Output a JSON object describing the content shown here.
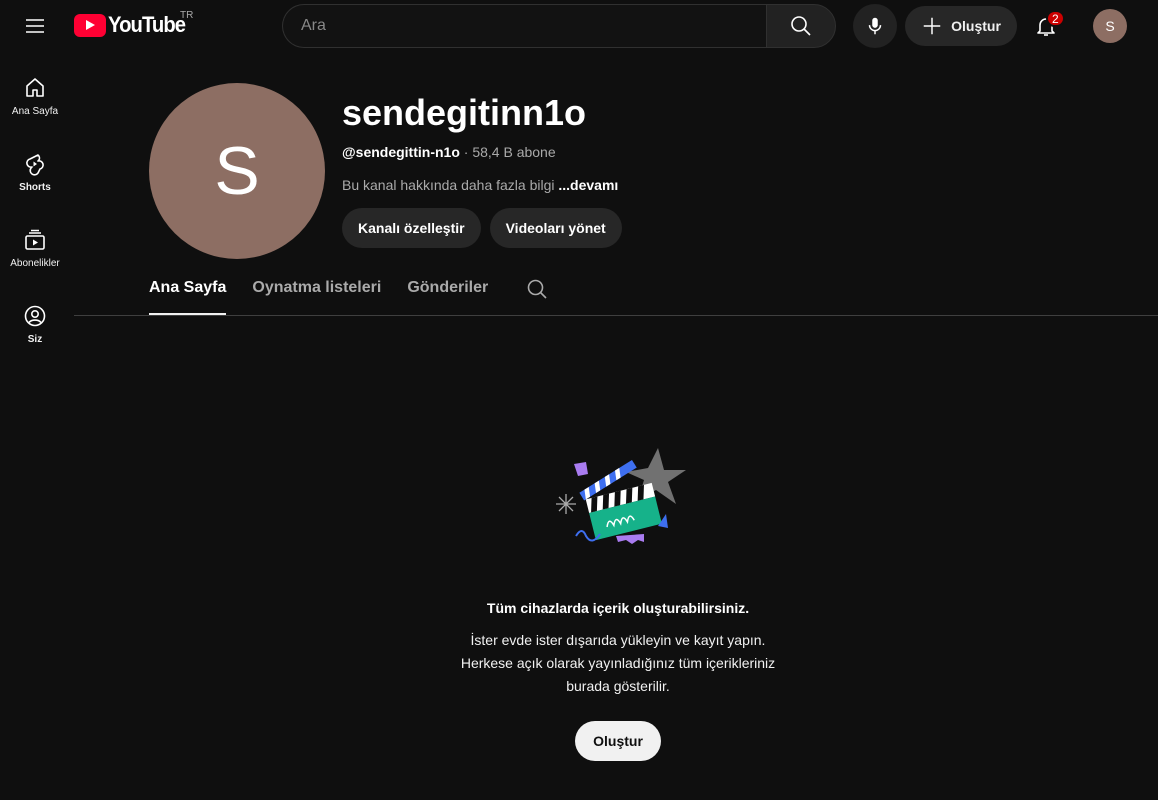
{
  "topbar": {
    "logo_text": "YouTube",
    "country_code": "TR",
    "search_placeholder": "Ara",
    "create_label": "Oluştur",
    "notification_count": "2",
    "avatar_letter": "S"
  },
  "sidebar": {
    "items": [
      {
        "label": "Ana Sayfa",
        "icon": "home-icon"
      },
      {
        "label": "Shorts",
        "icon": "shorts-icon"
      },
      {
        "label": "Abonelikler",
        "icon": "subscriptions-icon"
      },
      {
        "label": "Siz",
        "icon": "you-icon"
      }
    ]
  },
  "channel": {
    "avatar_letter": "S",
    "name": "sendegitinn1o",
    "handle": "@sendegittin-n1o",
    "separator": " · ",
    "subscribers": "58,4 B abone",
    "description": "Bu kanal hakkında daha fazla bilgi ",
    "more_label": "...devamı",
    "customize_label": "Kanalı özelleştir",
    "manage_label": "Videoları yönet"
  },
  "tabs": [
    {
      "label": "Ana Sayfa",
      "active": true
    },
    {
      "label": "Oynatma listeleri",
      "active": false
    },
    {
      "label": "Gönderiler",
      "active": false
    }
  ],
  "empty_state": {
    "title": "Tüm cihazlarda içerik oluşturabilirsiniz.",
    "line1": "İster evde ister dışarıda yükleyin ve kayıt yapın.",
    "line2": "Herkese açık olarak yayınladığınız tüm içerikleriniz",
    "line3": "burada gösterilir.",
    "button_label": "Oluştur"
  },
  "colors": {
    "background": "#0f0f0f",
    "brand_red": "#ff0033",
    "avatar": "#8d6e63",
    "pill": "#272727",
    "secondary_text": "#aaaaaa"
  }
}
